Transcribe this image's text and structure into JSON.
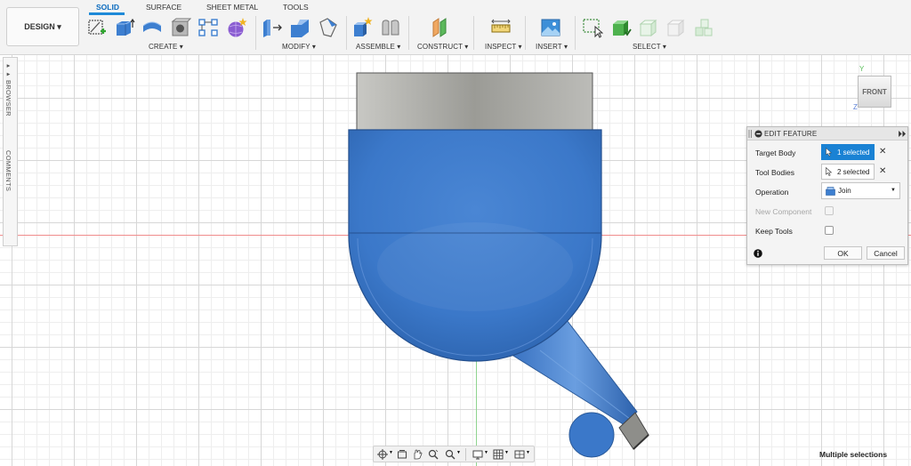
{
  "workspace": {
    "label": "DESIGN ▾"
  },
  "tabs": [
    {
      "label": "SOLID"
    },
    {
      "label": "SURFACE"
    },
    {
      "label": "SHEET METAL"
    },
    {
      "label": "TOOLS"
    }
  ],
  "groups": {
    "create": "CREATE ▾",
    "modify": "MODIFY ▾",
    "assemble": "ASSEMBLE ▾",
    "construct": "CONSTRUCT ▾",
    "inspect": "INSPECT ▾",
    "insert": "INSERT ▾",
    "select": "SELECT ▾"
  },
  "sidebar": {
    "browser": "▸▸ BROWSER",
    "comments": "COMMENTS"
  },
  "viewcube": {
    "face": "FRONT",
    "axis_y": "Y",
    "axis_z": "Z"
  },
  "edit_feature": {
    "title": "EDIT FEATURE",
    "target_body_label": "Target Body",
    "target_body_value": "1 selected",
    "tool_bodies_label": "Tool Bodies",
    "tool_bodies_value": "2 selected",
    "operation_label": "Operation",
    "operation_value": "Join",
    "new_component_label": "New Component",
    "keep_tools_label": "Keep Tools",
    "ok_label": "OK",
    "cancel_label": "Cancel"
  },
  "status": {
    "text": "Multiple selections"
  },
  "colors": {
    "accent": "#1a82d4",
    "body_blue": "#3b78c9",
    "metal_gray": "#a7a7a2"
  }
}
